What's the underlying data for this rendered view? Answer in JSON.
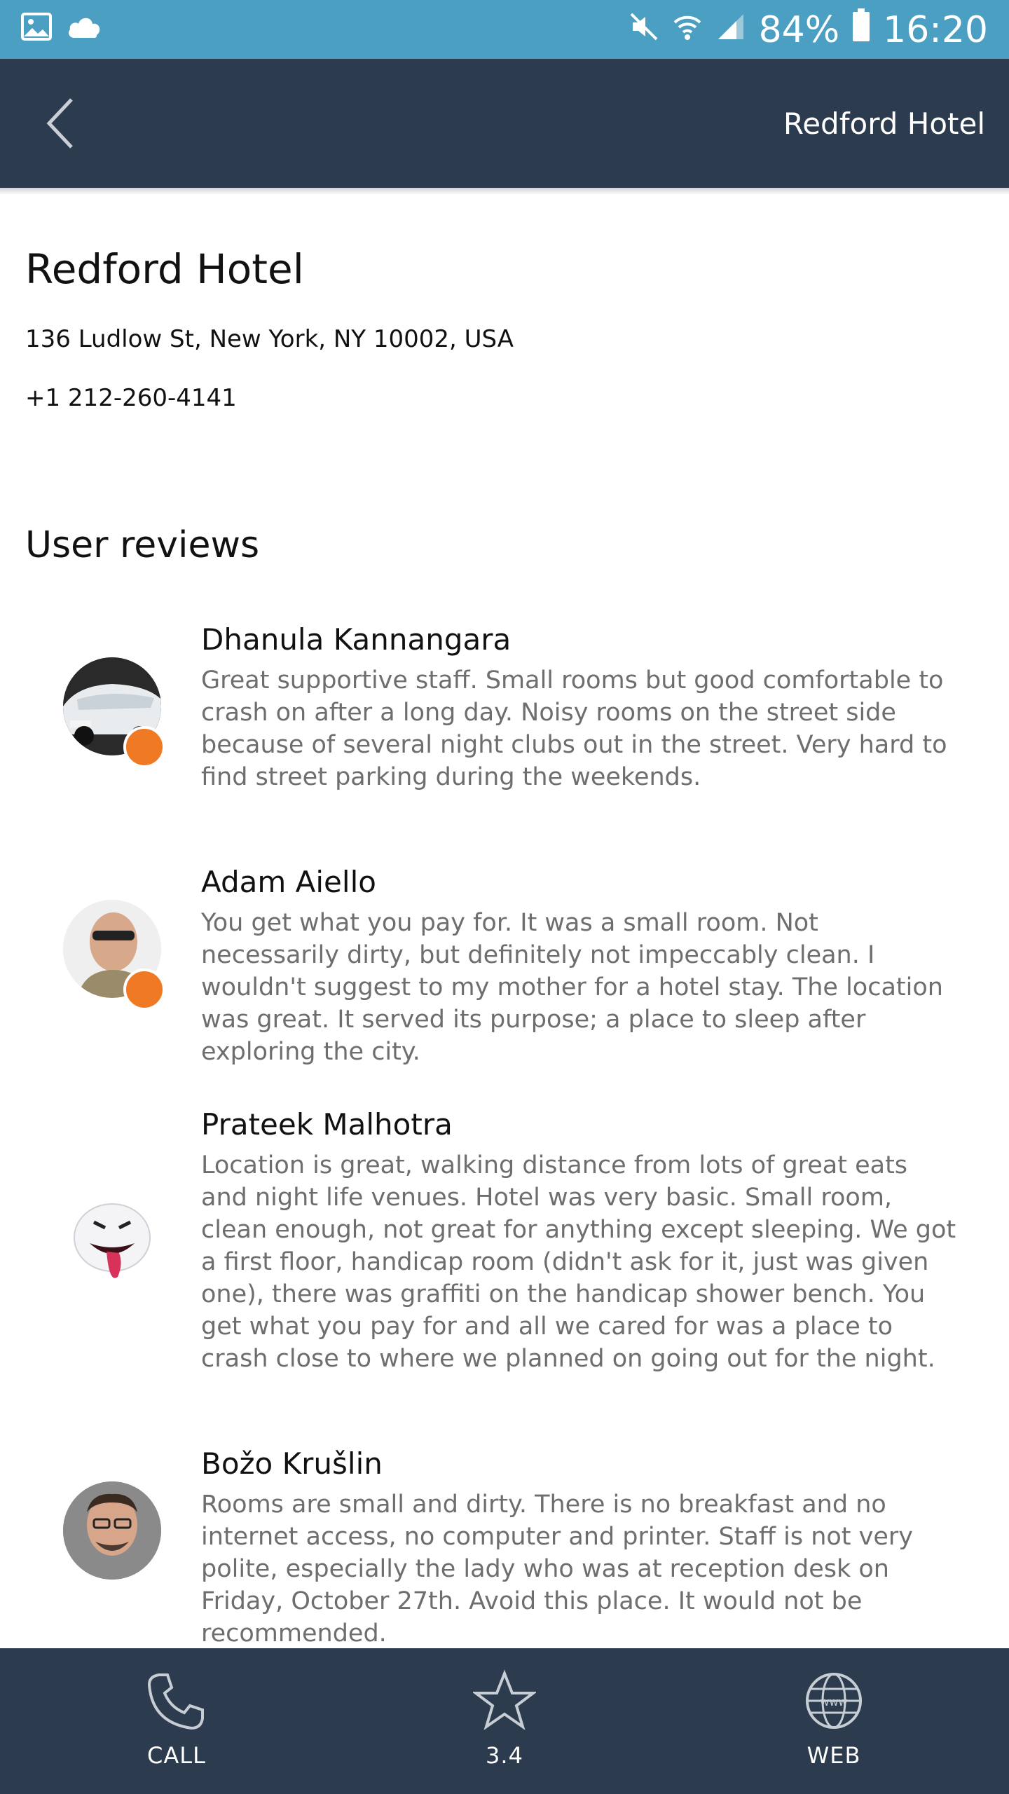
{
  "status_bar": {
    "battery": "84%",
    "time": "16:20",
    "icons": [
      "image-icon",
      "cloud-icon",
      "mute-icon",
      "wifi-icon",
      "signal-icon",
      "battery-icon"
    ]
  },
  "app_bar": {
    "title": "Redford Hotel",
    "back_icon": "chevron-left-icon"
  },
  "hotel": {
    "name": "Redford Hotel",
    "address": "136 Ludlow St, New York, NY 10002, USA",
    "phone": "+1 212-260-4141"
  },
  "reviews_title": "User reviews",
  "reviews": [
    {
      "name": "Dhanula Kannangara",
      "text": "Great supportive staff. Small rooms but good comfortable to crash on after a long day. Noisy rooms on the street side because of several night clubs out in the street. Very hard to find street parking during the weekends."
    },
    {
      "name": "Adam Aiello",
      "text": "You get what you pay for. It was a small room. Not necessarily dirty, but definitely not impeccably clean. I wouldn't suggest to my mother for a hotel stay. The location was great. It served its purpose; a place to sleep after exploring the city."
    },
    {
      "name": "Prateek Malhotra",
      "text": "Location is great, walking distance from lots of great eats and night life venues. Hotel was very basic. Small room, clean enough, not great for anything except sleeping. We got a first floor, handicap room (didn't ask for it, just was given one), there was graffiti on the handicap shower bench. You get what you pay for and all we cared for was a place to crash close to where we planned on going out for the night."
    },
    {
      "name": "Božo Krušlin",
      "text": "Rooms are small and dirty. There is no breakfast and no internet access, no computer and printer. Staff is not very polite, especially the lady who was at reception desk on Friday, October 27th. Avoid this place. It would not be recommended."
    }
  ],
  "bottom_bar": {
    "call_label": "CALL",
    "rating_label": "3.4",
    "web_label": "WEB"
  },
  "colors": {
    "status_bar": "#4a9fc2",
    "app_bar": "#2d3b4e",
    "badge": "#f07a23",
    "review_text": "#6e6e6e"
  }
}
